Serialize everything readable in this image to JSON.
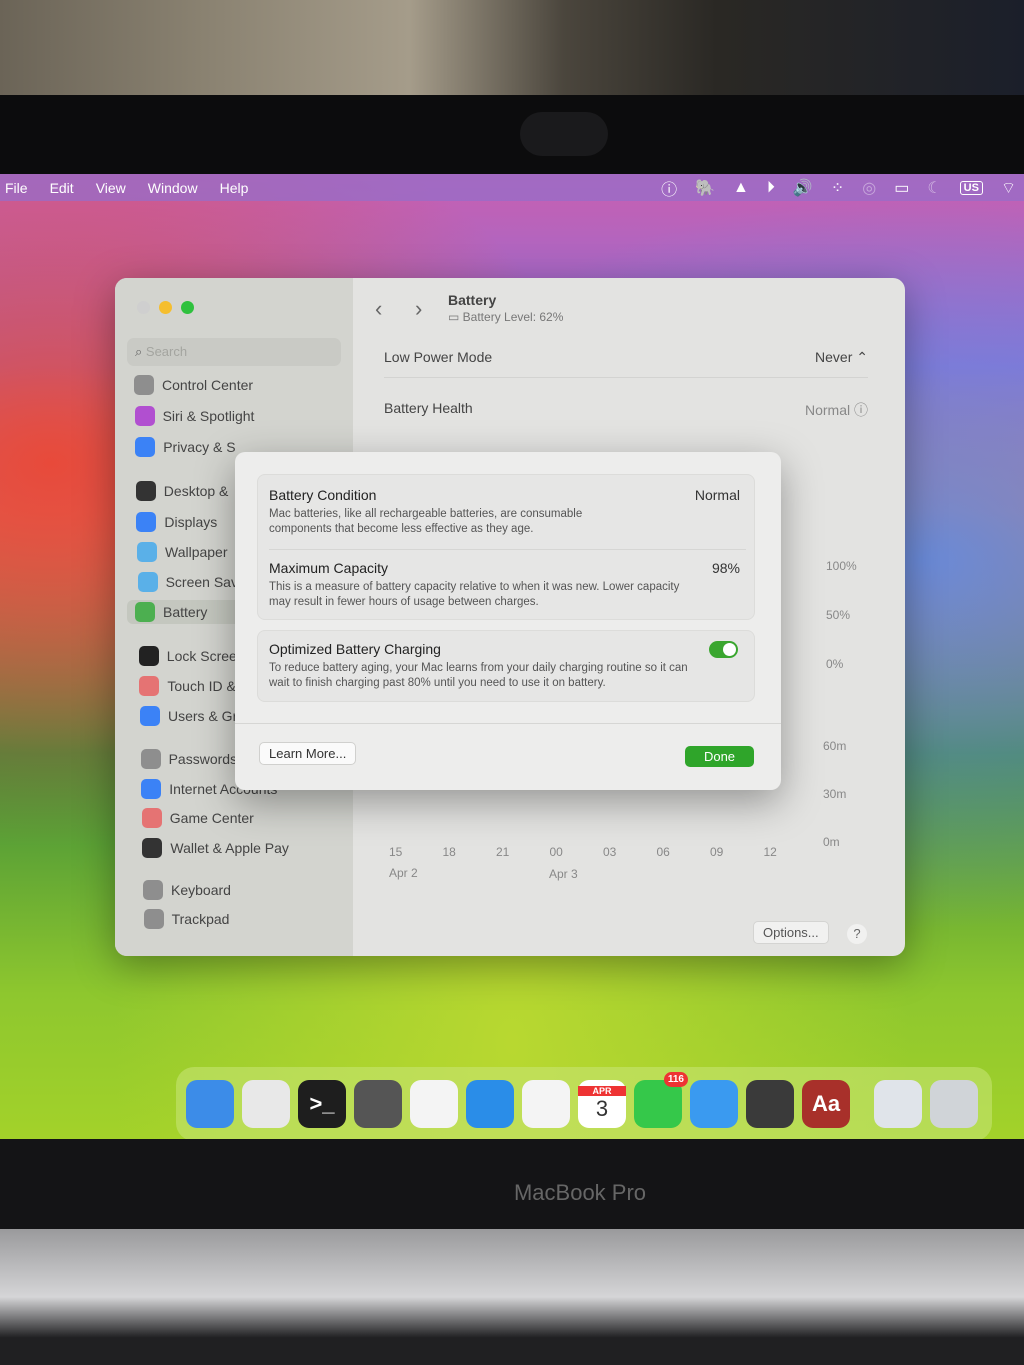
{
  "menubar": {
    "items": [
      "File",
      "Edit",
      "View",
      "Window",
      "Help"
    ],
    "status_icons": [
      "1password-icon",
      "elephant-icon",
      "triangle-icon",
      "play-icon",
      "volume-icon",
      "dots-icon",
      "airdrop-icon",
      "battery-icon",
      "moon-icon",
      "wifi-icon"
    ],
    "input_source": "US"
  },
  "window": {
    "search_placeholder": "Search",
    "sidebar": [
      {
        "label": "Control Center",
        "color": "#8e8e8e"
      },
      {
        "label": "Siri & Spotlight",
        "color": "#b14fd0"
      },
      {
        "label": "Privacy & S",
        "color": "#3b82f6"
      },
      {
        "label": "Desktop &",
        "color": "#333333"
      },
      {
        "label": "Displays",
        "color": "#3b82f6"
      },
      {
        "label": "Wallpaper",
        "color": "#5ab0e8"
      },
      {
        "label": "Screen Sav",
        "color": "#5ab0e8"
      },
      {
        "label": "Battery",
        "color": "#4caf50",
        "selected": true
      },
      {
        "label": "Lock Scree",
        "color": "#222222"
      },
      {
        "label": "Touch ID &",
        "color": "#e57373"
      },
      {
        "label": "Users & Gr",
        "color": "#3b82f6"
      },
      {
        "label": "Passwords",
        "color": "#8e8e8e"
      },
      {
        "label": "Internet Accounts",
        "color": "#3b82f6"
      },
      {
        "label": "Game Center",
        "color": "#e57373"
      },
      {
        "label": "Wallet & Apple Pay",
        "color": "#333333"
      },
      {
        "label": "Keyboard",
        "color": "#8e8e8e"
      },
      {
        "label": "Trackpad",
        "color": "#8e8e8e"
      }
    ],
    "title": "Battery",
    "subtitle": "Battery Level: 62%",
    "low_power_label": "Low Power Mode",
    "low_power_value": "Never",
    "health_label": "Battery Health",
    "health_value": "Normal",
    "chart_axis": {
      "pct": [
        "100%",
        "50%",
        "0%"
      ],
      "time": [
        "60m",
        "30m",
        "0m"
      ],
      "hours": [
        "15",
        "18",
        "21",
        "00",
        "03",
        "06",
        "09",
        "12"
      ],
      "dates": [
        "Apr 2",
        "Apr 3"
      ]
    },
    "options_button": "Options...",
    "help_button": "?"
  },
  "dialog": {
    "condition_title": "Battery Condition",
    "condition_value": "Normal",
    "condition_desc": "Mac batteries, like all rechargeable batteries, are consumable components that become less effective as they age.",
    "capacity_title": "Maximum Capacity",
    "capacity_value": "98%",
    "capacity_desc": "This is a measure of battery capacity relative to when it was new. Lower capacity may result in fewer hours of usage between charges.",
    "optimized_title": "Optimized Battery Charging",
    "optimized_on": true,
    "optimized_desc": "To reduce battery aging, your Mac learns from your daily charging routine so it can wait to finish charging past 80% until you need to use it on battery.",
    "learn_more": "Learn More...",
    "done": "Done",
    "accent": "#2fa52a"
  },
  "dock": [
    {
      "name": "finder",
      "bg": "#3c8ce8"
    },
    {
      "name": "launchpad",
      "bg": "#e8e8e8"
    },
    {
      "name": "terminal",
      "bg": "#1e1e1e",
      "glyph": ">_"
    },
    {
      "name": "system-settings",
      "bg": "#555555"
    },
    {
      "name": "vscode",
      "bg": "#f4f4f4"
    },
    {
      "name": "safari",
      "bg": "#2a8de8"
    },
    {
      "name": "slack",
      "bg": "#f4f4f4"
    },
    {
      "name": "calendar",
      "bg": "#ffffff",
      "month": "APR",
      "day": "3"
    },
    {
      "name": "messages",
      "bg": "#35c84a",
      "badge": "116"
    },
    {
      "name": "mail",
      "bg": "#3a9af0"
    },
    {
      "name": "calculator",
      "bg": "#3a3a3a"
    },
    {
      "name": "dictionary",
      "bg": "#a8302a",
      "glyph": "Aa"
    },
    {
      "name": "documents",
      "bg": "#e0e4ea"
    },
    {
      "name": "trash",
      "bg": "#d0d4d8"
    }
  ],
  "laptop_brand": "MacBook Pro"
}
